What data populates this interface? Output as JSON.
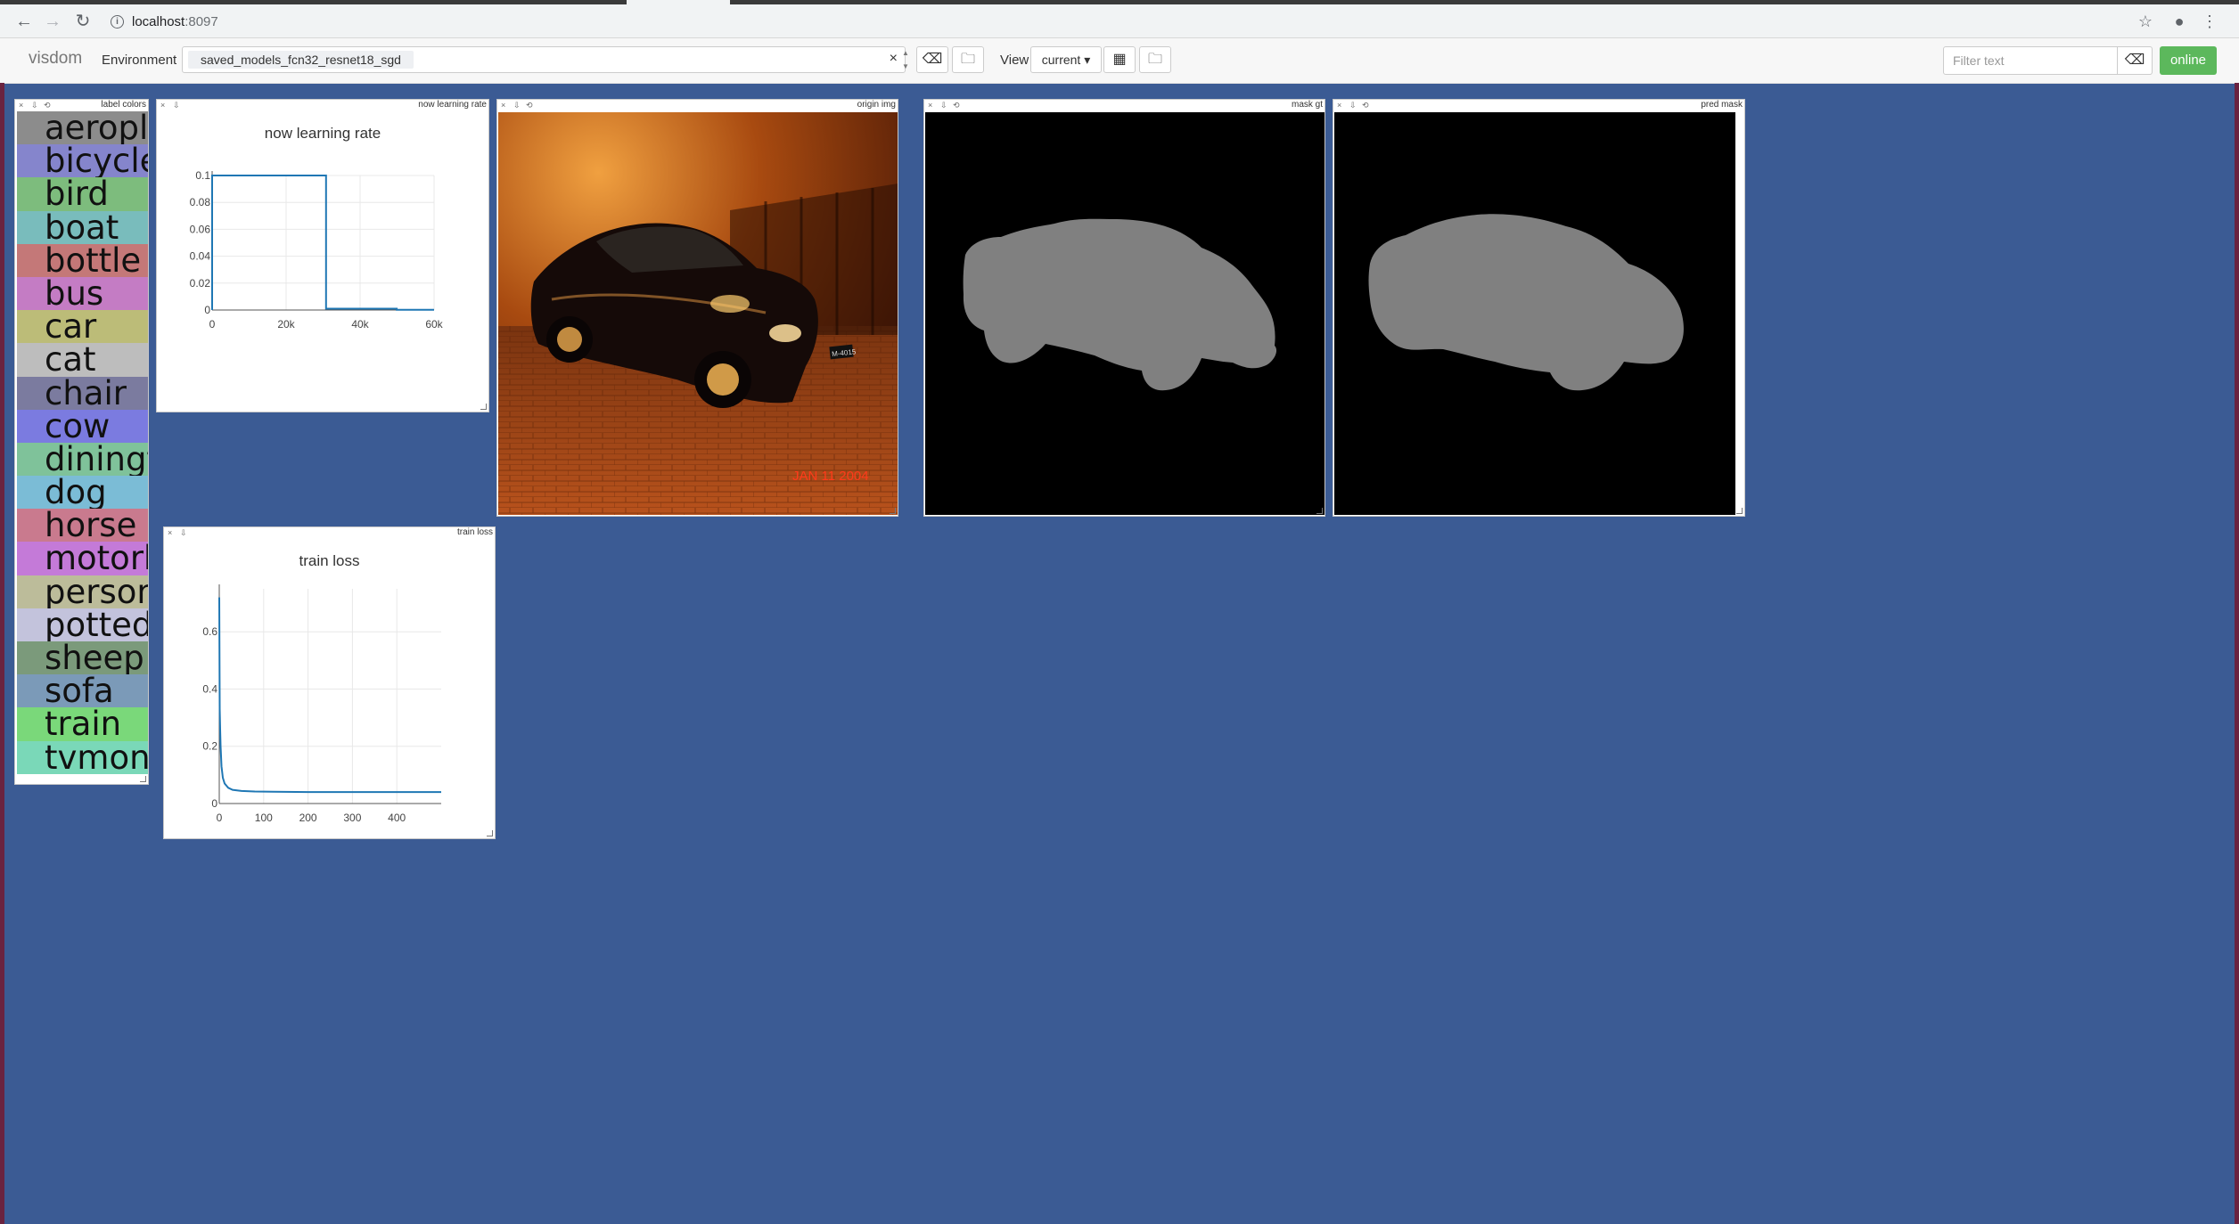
{
  "browser": {
    "url_host": "localhost",
    "url_port": ":8097"
  },
  "navbar": {
    "brand": "visdom",
    "env_label": "Environment",
    "env_selected": "saved_models_fcn32_resnet18_sgd",
    "env_clear": "×",
    "view_label": "View",
    "view_selected": "current ▾",
    "filter_placeholder": "Filter text",
    "status": "online",
    "colors": {
      "online": "#5cb85c",
      "background": "#3b5b94"
    }
  },
  "panes": {
    "label_colors": {
      "title": "label colors",
      "labels": [
        {
          "name": "aeroplane",
          "color": "#8c8c8c"
        },
        {
          "name": "bicycle",
          "color": "#8585cc"
        },
        {
          "name": "bird",
          "color": "#7dbc7d"
        },
        {
          "name": "boat",
          "color": "#79bcbc"
        },
        {
          "name": "bottle",
          "color": "#c47878"
        },
        {
          "name": "bus",
          "color": "#c47cc4"
        },
        {
          "name": "car",
          "color": "#bcbc78"
        },
        {
          "name": "cat",
          "color": "#bdbdbd"
        },
        {
          "name": "chair",
          "color": "#7b7b9f"
        },
        {
          "name": "cow",
          "color": "#7b7be0"
        },
        {
          "name": "diningtable",
          "color": "#7fc29a"
        },
        {
          "name": "dog",
          "color": "#7bbcd6"
        },
        {
          "name": "horse",
          "color": "#c97a8e"
        },
        {
          "name": "motorbike",
          "color": "#c47ad8"
        },
        {
          "name": "person",
          "color": "#bcbc9a"
        },
        {
          "name": "pottedplant",
          "color": "#c3c3dc"
        },
        {
          "name": "sheep",
          "color": "#7b9a7b"
        },
        {
          "name": "sofa",
          "color": "#7b9ab8"
        },
        {
          "name": "train",
          "color": "#7ad87a"
        },
        {
          "name": "tvmonitor",
          "color": "#7ad8b8"
        }
      ]
    },
    "learning_rate": {
      "title": "now learning rate"
    },
    "origin_img": {
      "title": "origin img",
      "stamp": "JAN 11 2004",
      "plate": "M-4015"
    },
    "mask_gt": {
      "title": "mask gt"
    },
    "pred_mask": {
      "title": "pred mask"
    },
    "train_loss": {
      "title": "train loss"
    }
  },
  "chart_data": [
    {
      "type": "line",
      "title": "now learning rate",
      "xlabel": "",
      "ylabel": "",
      "xlim": [
        0,
        60000
      ],
      "ylim": [
        0,
        0.1
      ],
      "x_ticks": [
        "0",
        "20k",
        "40k",
        "60k"
      ],
      "y_ticks": [
        "0",
        "0.02",
        "0.04",
        "0.06",
        "0.08",
        "0.1"
      ],
      "grid": true,
      "series": [
        {
          "color": "#1f77b4",
          "x": [
            0,
            0,
            30800,
            30800,
            49900,
            49900,
            60000
          ],
          "y": [
            0,
            0.1,
            0.1,
            0.001,
            0.001,
            0.0001,
            0.0001
          ]
        }
      ]
    },
    {
      "type": "line",
      "title": "train loss",
      "xlabel": "",
      "ylabel": "",
      "xlim": [
        0,
        500
      ],
      "ylim": [
        0,
        0.75
      ],
      "x_ticks": [
        "0",
        "100",
        "200",
        "300",
        "400"
      ],
      "y_ticks": [
        "0",
        "0.2",
        "0.4",
        "0.6"
      ],
      "grid": true,
      "series": [
        {
          "color": "#1f77b4",
          "x": [
            0,
            1,
            2,
            3,
            5,
            8,
            12,
            20,
            30,
            50,
            80,
            120,
            200,
            300,
            400,
            500
          ],
          "y": [
            0.72,
            0.33,
            0.26,
            0.2,
            0.13,
            0.09,
            0.07,
            0.055,
            0.048,
            0.044,
            0.042,
            0.041,
            0.04,
            0.04,
            0.04,
            0.04
          ]
        }
      ]
    }
  ]
}
